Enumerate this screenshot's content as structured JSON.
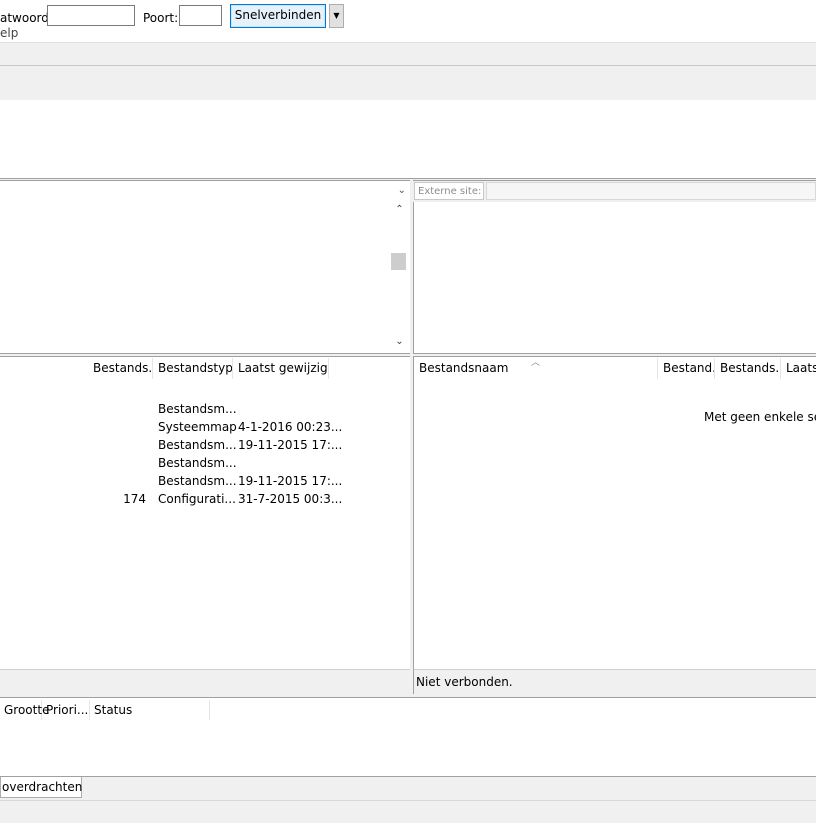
{
  "menubar": {
    "help_label": "elp"
  },
  "quickconnect": {
    "password_label": "atwoord:",
    "password_value": "",
    "port_label": "Poort:",
    "port_value": "",
    "connect_label": "Snelverbinden",
    "dropdown_icon": "caret-down-icon"
  },
  "local": {
    "site_value": "",
    "columns": [
      "Bestands...",
      "Bestandstype",
      "Laatst gewijzigd"
    ],
    "rows": [
      {
        "size": "",
        "type": "Bestandsm...",
        "modified": ""
      },
      {
        "size": "",
        "type": "Systeemmap",
        "modified": "4-1-2016 00:23..."
      },
      {
        "size": "",
        "type": "Bestandsm...",
        "modified": "19-11-2015 17:..."
      },
      {
        "size": "",
        "type": "Bestandsm...",
        "modified": ""
      },
      {
        "size": "",
        "type": "Bestandsm...",
        "modified": "19-11-2015 17:..."
      },
      {
        "size": "174",
        "type": "Configurati...",
        "modified": "31-7-2015 00:3..."
      }
    ],
    "status_text": ""
  },
  "remote": {
    "site_label": "Externe site:",
    "site_value": "",
    "columns": [
      "Bestandsnaam",
      "Bestand...",
      "Bestands...",
      "Laatst"
    ],
    "empty_message": "Met geen enkele serv",
    "status_text": "Niet verbonden."
  },
  "queue": {
    "columns": [
      "Grootte",
      "Priori...",
      "Status"
    ],
    "tab_label": "overdrachten"
  },
  "colors": {
    "accent": "#0078d7",
    "button_bg": "#e5f1fb",
    "panel_bg": "#f0f0f0",
    "border": "#a0a0a0"
  }
}
